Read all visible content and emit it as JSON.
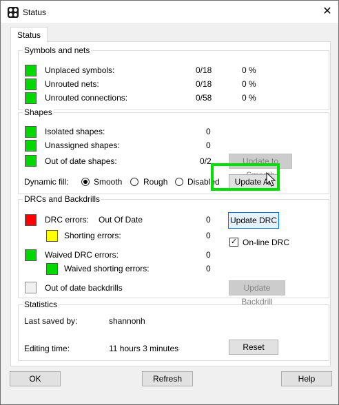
{
  "window": {
    "title": "Status",
    "close_glyph": "✕"
  },
  "tab": {
    "label": "Status"
  },
  "symbols_nets": {
    "title": "Symbols and nets",
    "rows": [
      {
        "label": "Unplaced symbols:",
        "count": "0/18",
        "percent": "0 %",
        "status_color": "#00d800"
      },
      {
        "label": "Unrouted nets:",
        "count": "0/18",
        "percent": "0 %",
        "status_color": "#00d800"
      },
      {
        "label": "Unrouted connections:",
        "count": "0/58",
        "percent": "0 %",
        "status_color": "#00d800"
      }
    ]
  },
  "shapes": {
    "title": "Shapes",
    "rows": [
      {
        "label": "Isolated shapes:",
        "count": "0",
        "status_color": "#00d800"
      },
      {
        "label": "Unassigned shapes:",
        "count": "0",
        "status_color": "#00d800"
      },
      {
        "label": "Out of date shapes:",
        "count": "0/2",
        "status_color": "#00d800"
      }
    ],
    "update_smooth_label": "Update to Smooth",
    "dynamic_fill_label": "Dynamic fill:",
    "fill_options": [
      {
        "label": "Smooth",
        "selected": true
      },
      {
        "label": "Rough",
        "selected": false
      },
      {
        "label": "Disabled",
        "selected": false
      }
    ],
    "update_all_label": "Update All"
  },
  "drc": {
    "title": "DRCs and Backdrills",
    "drc_errors_label": "DRC errors:",
    "drc_status": "Out Of Date",
    "drc_errors_count": "0",
    "shorting_label": "Shorting errors:",
    "shorting_count": "0",
    "waived_label": "Waived DRC errors:",
    "waived_count": "0",
    "waived_shorting_label": "Waived shorting errors:",
    "waived_shorting_count": "0",
    "backdrill_label": "Out of date backdrills",
    "update_drc_label": "Update DRC",
    "online_drc_label": "On-line DRC",
    "online_drc_checked": "✓",
    "update_backdrill_label": "Update Backdrill",
    "colors": {
      "drc": "#ff0000",
      "shorting": "#ffff00",
      "waived": "#00d800",
      "backdrill": "#f0f0f0"
    }
  },
  "statistics": {
    "title": "Statistics",
    "last_saved_label": "Last saved by:",
    "last_saved_value": "shannonh",
    "editing_time_label": "Editing time:",
    "editing_time_value": "11 hours 3 minutes",
    "reset_label": "Reset"
  },
  "footer": {
    "ok_label": "OK",
    "refresh_label": "Refresh",
    "help_label": "Help"
  }
}
